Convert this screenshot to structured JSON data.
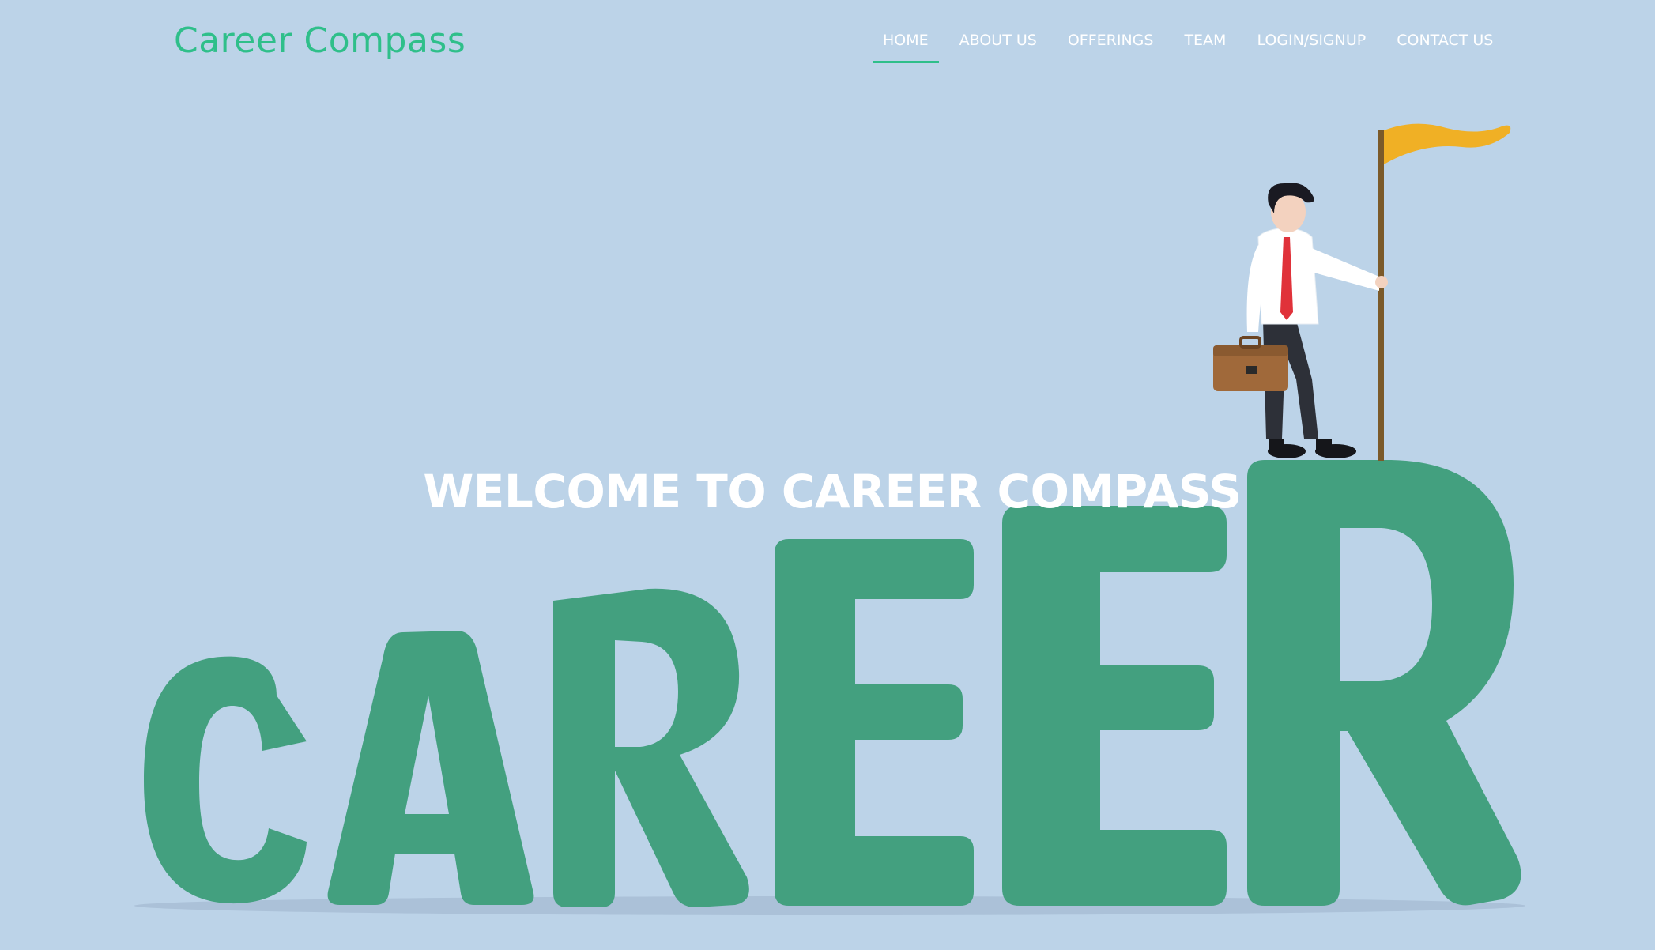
{
  "brand": {
    "name": "Career Compass",
    "accent_color": "#2fbf8a",
    "background_color": "#bcd3e8"
  },
  "nav": {
    "items": [
      {
        "label": "HOME",
        "active": true
      },
      {
        "label": "ABOUT US",
        "active": false
      },
      {
        "label": "OFFERINGS",
        "active": false
      },
      {
        "label": "TEAM",
        "active": false
      },
      {
        "label": "LOGIN/SIGNUP",
        "active": false
      },
      {
        "label": "CONTACT US",
        "active": false
      }
    ]
  },
  "hero": {
    "headline": "WELCOME TO CAREER COMPASS",
    "illustration_word": "cAREER",
    "illustration_color": "#43a07f",
    "flag_color": "#f0b025",
    "tie_color": "#e0323a"
  }
}
